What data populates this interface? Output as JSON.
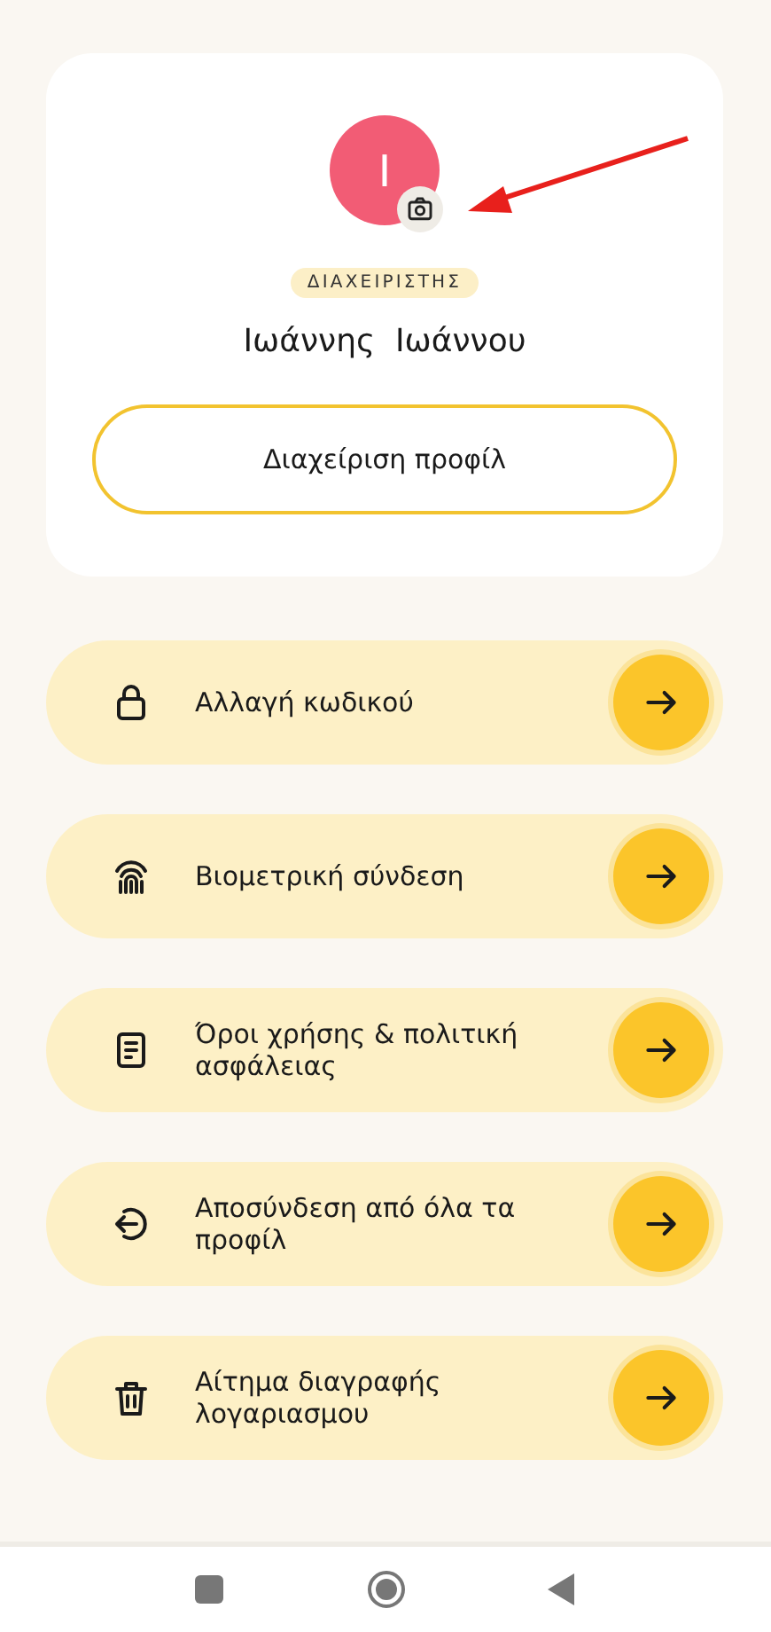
{
  "profile": {
    "avatar_initial": "I",
    "role_badge": "ΔΙΑΧΕΙΡΙΣΤΗΣ",
    "name": "Ιωάννης  Ιωάννου",
    "manage_button": "Διαχείριση προφίλ"
  },
  "menu": [
    {
      "kind": "lock",
      "label": "Αλλαγή κωδικού"
    },
    {
      "kind": "fingerprint",
      "label": "Βιομετρική σύνδεση"
    },
    {
      "kind": "document",
      "label": "Όροι χρήσης & πολιτική ασφάλειας"
    },
    {
      "kind": "logout",
      "label": "Αποσύνδεση από όλα τα προφίλ"
    },
    {
      "kind": "trash",
      "label": "Αίτημα διαγραφής λογαριασμου"
    }
  ]
}
